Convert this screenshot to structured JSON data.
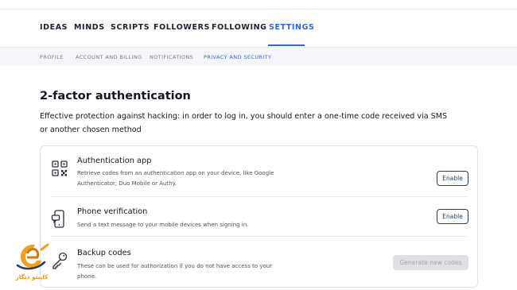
{
  "main_nav": {
    "tabs": [
      {
        "label": "IDEAS"
      },
      {
        "label": "MINDS"
      },
      {
        "label": "SCRIPTS"
      },
      {
        "label": "FOLLOWERS"
      },
      {
        "label": "FOLLOWING"
      },
      {
        "label": "SETTINGS",
        "active": true
      }
    ]
  },
  "sub_nav": {
    "tabs": [
      {
        "label": "PROFILE"
      },
      {
        "label": "ACCOUNT AND BILLING"
      },
      {
        "label": "NOTIFICATIONS"
      },
      {
        "label": "PRIVACY AND SECURITY",
        "active": true
      }
    ]
  },
  "page": {
    "title": "2-factor authentication",
    "intro": "Effective protection against hacking: in order to log in, you should enter a one-time code received via SMS or another chosen method"
  },
  "methods": [
    {
      "title": "Authentication app",
      "description": "Retrieve codes from an authentication app on your device, like Google Authenticator, Duo Mobile or Authy.",
      "button": "Enable",
      "icon": "qr-code-icon"
    },
    {
      "title": "Phone verification",
      "description": "Send a text message to your mobile devices when signing in.",
      "button": "Enable",
      "icon": "phone-icon"
    },
    {
      "title": "Backup codes",
      "description": "These can be used for authorization if you do not have access to your phone.",
      "button": "Generate new codes",
      "button_disabled": true,
      "icon": "key-icon"
    }
  ],
  "watermark": {
    "text": "کاپیتو دیگار",
    "icon": "brand-logo-icon"
  },
  "colors": {
    "accent": "#2962ff",
    "text": "#131722",
    "muted": "#787b86",
    "subnav_bg": "#f3f6fb",
    "button_border": "#2a3b66",
    "watermark": "#e8961f"
  }
}
